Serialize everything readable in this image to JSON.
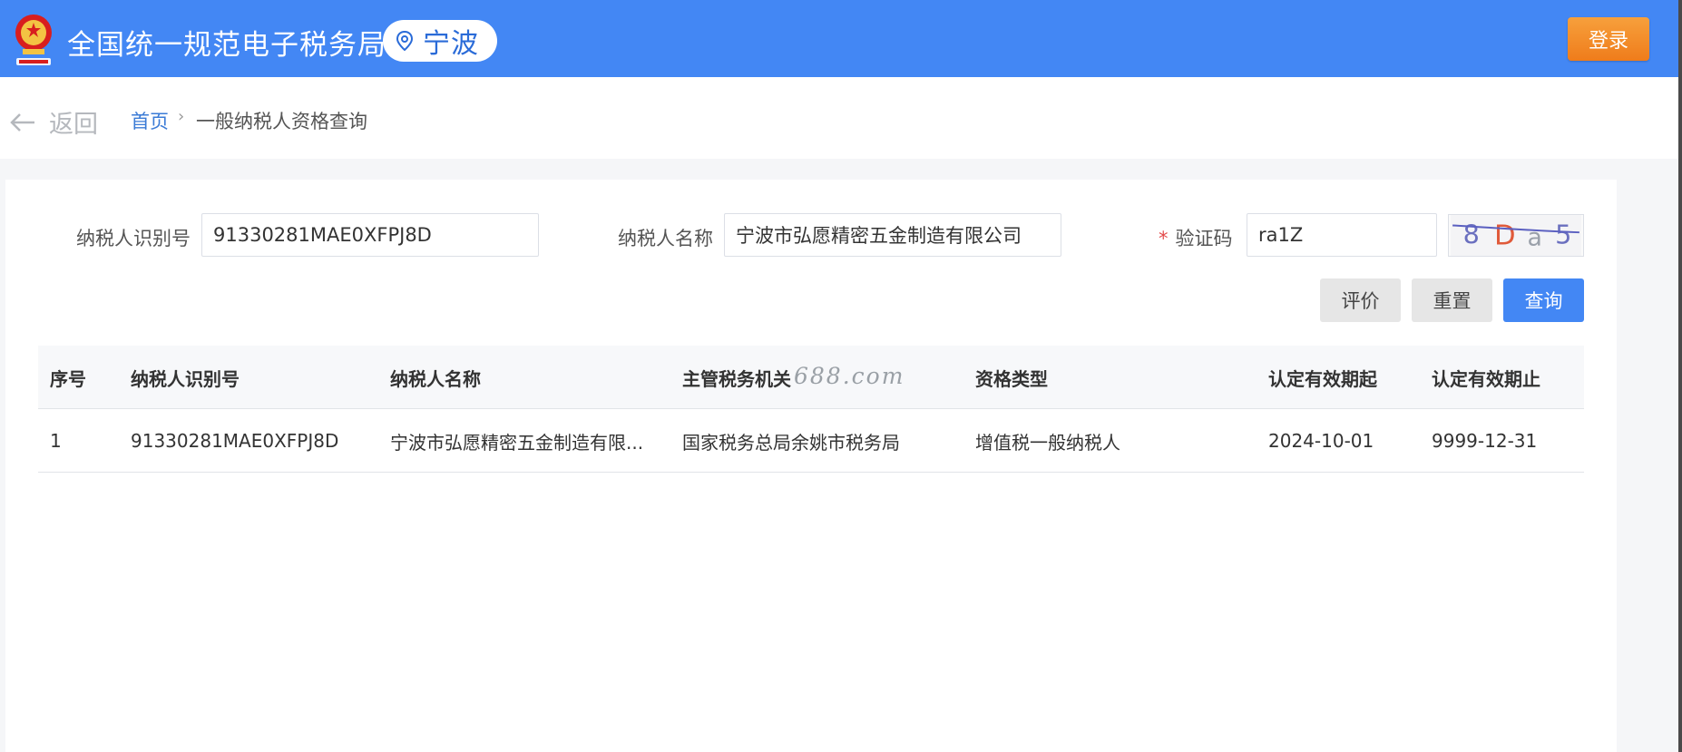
{
  "header": {
    "site_title": "全国统一规范电子税务局",
    "region": "宁波",
    "login_label": "登录",
    "emblem_icon": "national-emblem-icon",
    "pin_icon": "location-pin-icon"
  },
  "breadcrumb": {
    "back_label": "返回",
    "home": "首页",
    "separator": "›",
    "current": "一般纳税人资格查询"
  },
  "form": {
    "taxpayer_id_label": "纳税人识别号",
    "taxpayer_id_value": "91330281MAE0XFPJ8D",
    "taxpayer_name_label": "纳税人名称",
    "taxpayer_name_value": "宁波市弘愿精密五金制造有限公司",
    "required_mark": "*",
    "captcha_label": "验证码",
    "captcha_value": "ra1Z",
    "captcha_image_text": "8Da5"
  },
  "buttons": {
    "evaluate": "评价",
    "reset": "重置",
    "query": "查询"
  },
  "table": {
    "columns": [
      "序号",
      "纳税人识别号",
      "纳税人名称",
      "主管税务机关",
      "资格类型",
      "认定有效期起",
      "认定有效期止"
    ],
    "rows": [
      [
        "1",
        "91330281MAE0XFPJ8D",
        "宁波市弘愿精密五金制造有限...",
        "国家税务总局余姚市税务局",
        "增值税一般纳税人",
        "2024-10-01",
        "9999-12-31"
      ]
    ]
  },
  "watermark": "688.com",
  "colors": {
    "header_bg": "#4387f4",
    "login_bg": "#ef7c1b",
    "query_bg": "#4387f4",
    "link": "#3b7bd6"
  }
}
